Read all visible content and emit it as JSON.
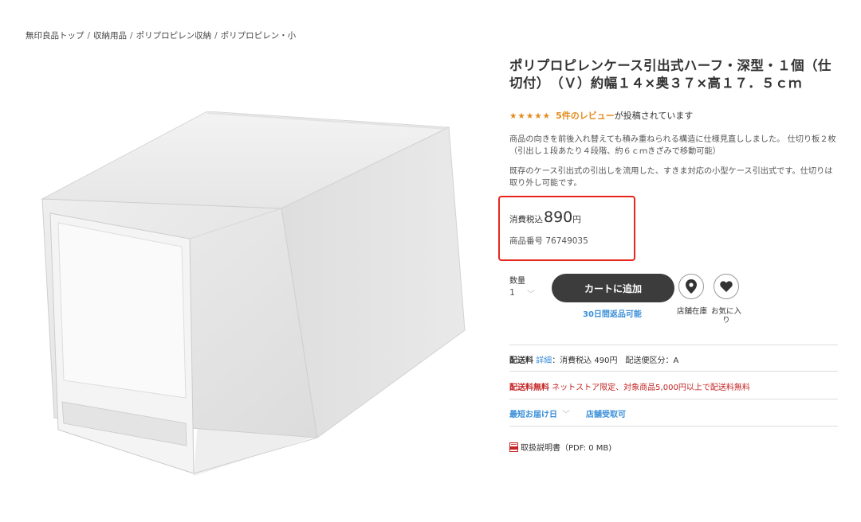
{
  "breadcrumb": {
    "items": [
      "無印良品トップ",
      "収納用品",
      "ポリプロピレン収納",
      "ポリプロピレン・小"
    ],
    "separator": "/"
  },
  "product": {
    "title": "ポリプロピレンケース引出式ハーフ・深型・１個（仕切付）　（Ｖ）約幅１４×奥３７×高１７．５ｃｍ",
    "rating": {
      "stars": "★★★★★",
      "review_link": "5件のレビュー",
      "suffix": "が投稿されています",
      "value": 4.5
    },
    "description_1": "商品の向きを前後入れ替えても積み重ねられる構造に仕様見直ししました。 仕切り板２枚（引出し１段あたり４段階、約６ｃｍきざみで移動可能）",
    "description_2": "既存のケース引出式の引出しを流用した、すきま対応の小型ケース引出式です。仕切りは取り外し可能です。",
    "price_label": "消費税込",
    "price_value": "890",
    "price_unit": "円",
    "code_label": "商品番号",
    "code_value": "76749035"
  },
  "purchase": {
    "qty_label": "数量",
    "qty_value": "1",
    "cart_button": "カートに追加",
    "return_note": "30日間返品可能",
    "store_stock_label": "店舗在庫",
    "favorite_label": "お気に入り"
  },
  "shipping": {
    "fee_label": "配送料",
    "detail_link": "詳細",
    "fee_text": "：消費税込 490円　配送便区分：A",
    "free_label": "配送料無料",
    "free_text": "ネットストア限定、対象商品5,000円以上で配送料無料",
    "earliest_label": "最短お届け日",
    "store_pickup": "店舗受取可"
  },
  "manual": {
    "text": "取扱説明書（PDF: 0 MB)"
  },
  "colors": {
    "accent_orange": "#e48a1c",
    "link_blue": "#3b8fd9",
    "highlight_red": "#e8261d",
    "button_dark": "#3c3c3c",
    "free_red": "#c52424"
  }
}
